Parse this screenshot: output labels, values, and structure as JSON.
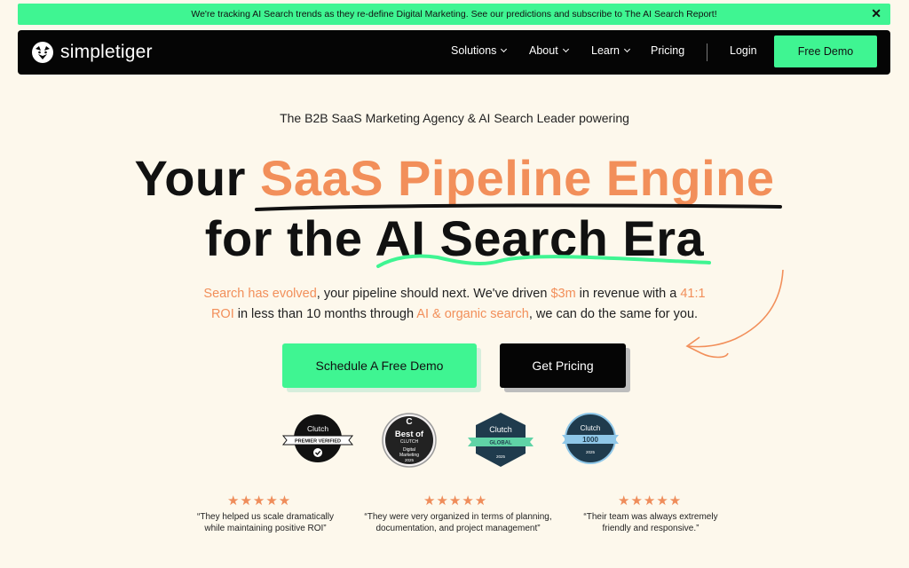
{
  "announcement": {
    "text": "We're tracking AI Search trends as they re-define Digital Marketing. See our predictions and subscribe to The AI Search Report!",
    "close": "✕"
  },
  "nav": {
    "logo_text": "simpletiger",
    "items": [
      {
        "label": "Solutions"
      },
      {
        "label": "About"
      },
      {
        "label": "Learn"
      },
      {
        "label": "Pricing"
      }
    ],
    "login": "Login",
    "cta": "Free Demo"
  },
  "hero": {
    "tagline": "The B2B SaaS Marketing Agency & AI Search Leader powering",
    "line1_plain": "Your ",
    "line1_accent": "SaaS Pipeline Engine",
    "line2_plain": "for the ",
    "line2_accent": "AI Search Era",
    "sub": {
      "p1_hl": "Search has evolved",
      "p1_a": ", your pipeline should next. We've driven ",
      "p1_hl2": "$3m",
      "p1_b": " in revenue with a ",
      "p1_hl3": "41:1",
      "p2_hl": "ROI",
      "p2_a": " in less than 10 months through ",
      "p2_hl2": "AI & organic search",
      "p2_b": ", we can do the same for you."
    },
    "cta_primary": "Schedule A Free Demo",
    "cta_secondary": "Get Pricing"
  },
  "badges": {
    "b1": {
      "brand": "Clutch",
      "ribbon": "PREMIER VERIFIED"
    },
    "b2": {
      "top": "Best of",
      "brand": "CLUTCH",
      "sub1": "Digital",
      "sub2": "Marketing",
      "year": "2025"
    },
    "b3": {
      "brand": "Clutch",
      "ribbon": "GLOBAL",
      "year": "2025"
    },
    "b4": {
      "brand": "Clutch",
      "ribbon": "1000",
      "year": "2025"
    }
  },
  "reviews": [
    {
      "stars": "★★★★★",
      "line1": "“They helped us scale dramatically",
      "line2": "while maintaining positive ROI”"
    },
    {
      "stars": "★★★★★",
      "line1": "“They were very organized in terms of planning,",
      "line2": "documentation, and project management”"
    },
    {
      "stars": "★★★★★",
      "line1": "“Their team was always extremely",
      "line2": "friendly and responsive.”"
    }
  ],
  "colors": {
    "accent_green": "#3ff592",
    "accent_orange": "#f28f5a",
    "background": "#fdf8ec",
    "nav_bg": "#050505"
  }
}
